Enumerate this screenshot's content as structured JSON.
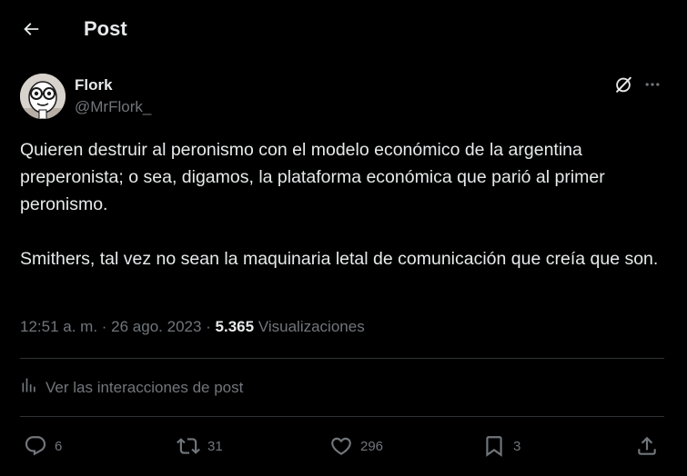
{
  "header": {
    "title": "Post",
    "back_icon": "arrow-left-icon"
  },
  "author": {
    "name": "Flork",
    "handle": "@MrFlork_",
    "avatar_icon": "flork-cartoon-avatar"
  },
  "post": {
    "paragraphs": [
      "Quieren destruir al peronismo con el modelo económico de la argentina preperonista; o sea, digamos, la plataforma económica que parió al primer peronismo.",
      "Smithers, tal vez no sean la maquinaria letal de comunicación que creía que son."
    ]
  },
  "meta": {
    "time": "12:51 a. m.",
    "sep": " · ",
    "date": "26 ago. 2023",
    "views_count": "5.365",
    "views_label": "Visualizaciones"
  },
  "interactions_link": {
    "label": "Ver las interacciones de post",
    "icon": "analytics-bars-icon"
  },
  "actions": {
    "replies": "6",
    "reposts": "31",
    "likes": "296",
    "bookmarks": "3"
  },
  "colors": {
    "background": "#000000",
    "text_primary": "#e7e9ea",
    "text_secondary": "#71767b",
    "divider": "#2f3336"
  }
}
